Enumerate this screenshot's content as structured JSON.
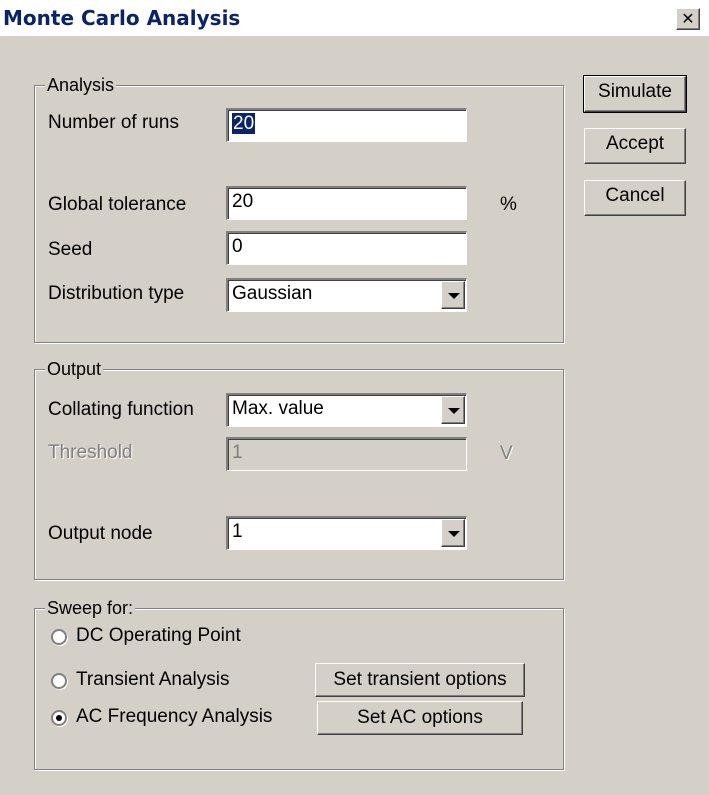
{
  "window": {
    "title": "Monte Carlo Analysis",
    "close_glyph": "✕"
  },
  "buttons": {
    "simulate": "Simulate",
    "accept": "Accept",
    "cancel": "Cancel"
  },
  "analysis": {
    "legend": "Analysis",
    "runs_label": "Number of runs",
    "runs_value": "20",
    "tolerance_label": "Global tolerance",
    "tolerance_value": "20",
    "tolerance_unit": "%",
    "seed_label": "Seed",
    "seed_value": "0",
    "distribution_label": "Distribution type",
    "distribution_value": "Gaussian"
  },
  "output": {
    "legend": "Output",
    "collating_label": "Collating function",
    "collating_value": "Max. value",
    "threshold_label": "Threshold",
    "threshold_value": "1",
    "threshold_unit": "V",
    "node_label": "Output node",
    "node_value": "1"
  },
  "sweep": {
    "legend": "Sweep for:",
    "options": [
      {
        "label": "DC Operating Point",
        "selected": false
      },
      {
        "label": "Transient Analysis",
        "selected": false
      },
      {
        "label": "AC Frequency Analysis",
        "selected": true
      }
    ],
    "transient_button": "Set transient options",
    "ac_button": "Set AC options"
  },
  "icons": {
    "dropdown": "chevron-down-icon",
    "close": "close-icon"
  }
}
